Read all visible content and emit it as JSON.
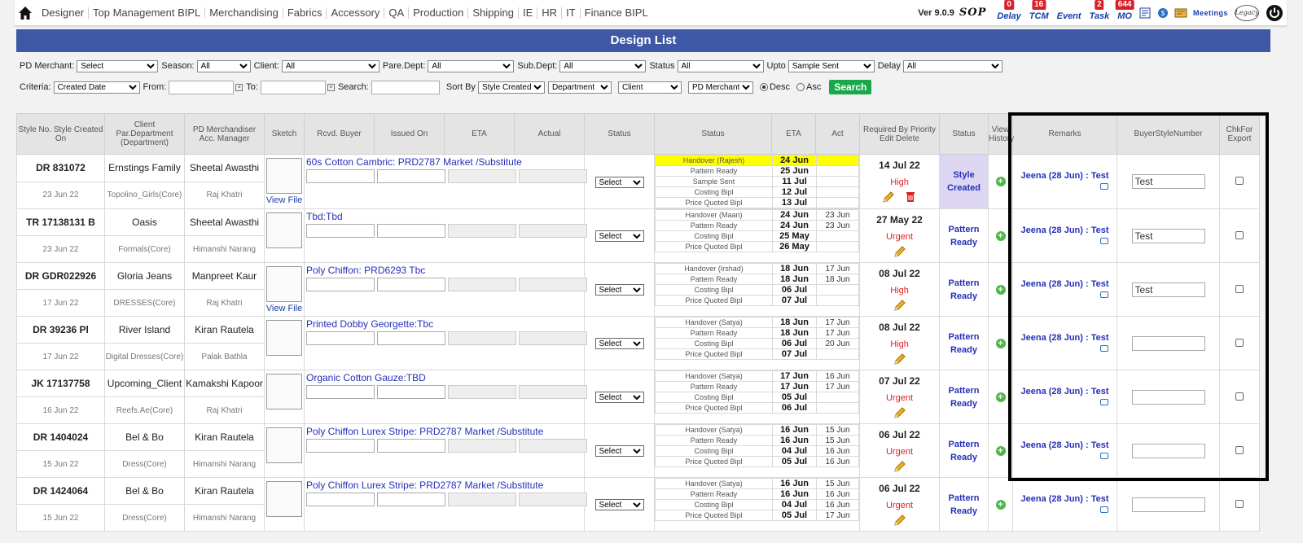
{
  "nav": {
    "menu": [
      "Designer",
      "Top Management BIPL",
      "Merchandising",
      "Fabrics",
      "Accessory",
      "QA",
      "Production",
      "Shipping",
      "IE",
      "HR",
      "IT",
      "Finance BIPL"
    ],
    "version": "Ver 9.0.9",
    "sop": "SOP",
    "tools": [
      {
        "label": "Delay",
        "badge": "0"
      },
      {
        "label": "TCM",
        "badge": "16"
      },
      {
        "label": "Event",
        "badge": ""
      },
      {
        "label": "Task",
        "badge": "2"
      },
      {
        "label": "MO",
        "badge": "644"
      }
    ],
    "meetings": "Meetings",
    "legacy": "Legacy"
  },
  "title": "Design List",
  "filters": {
    "pd_merchant_label": "PD Merchant:",
    "pd_merchant": "Select",
    "season_label": "Season:",
    "season": "All",
    "client_label": "Client:",
    "client": "All",
    "pare_dept_label": "Pare.Dept:",
    "pare_dept": "All",
    "sub_dept_label": "Sub.Dept:",
    "sub_dept": "All",
    "status_label": "Status",
    "status": "All",
    "upto_label": "Upto",
    "upto": "Sample Sent",
    "delay_label": "Delay",
    "delay": "All",
    "criteria_label": "Criteria:",
    "criteria": "Created Date",
    "from_label": "From:",
    "to_label": "To:",
    "search_label": "Search:",
    "sort_label": "Sort By",
    "sort1": "Style Created",
    "sort2": "Department",
    "sort3": "Client",
    "sort4": "PD Merchant",
    "desc": "Desc",
    "asc": "Asc",
    "search_btn": "Search"
  },
  "headers": {
    "style": "Style No. Style Created On",
    "client": "Client Par.Department (Department)",
    "pdm": "PD Merchandiser Acc. Manager",
    "sketch": "Sketch",
    "rcvd": "Rcvd. Buyer",
    "issued": "Issued On",
    "eta": "ETA",
    "actual": "Actual",
    "status1": "Status",
    "status2": "Status",
    "eta2": "ETA",
    "act": "Act",
    "required": "Required By Priority Edit   Delete",
    "status3": "Status",
    "view": "View History",
    "remarks": "Remarks",
    "bsn": "BuyerStyleNumber",
    "chk": "ChkFor Export"
  },
  "rows": [
    {
      "style": "DR 831072",
      "date": "23 Jun 22",
      "client": "Ernstings Family",
      "dept": "Topolino_Girls(Core)",
      "pdm": "Sheetal Awasthi",
      "am": "Raj Khatri",
      "view_file": "View File",
      "fabric": "60s Cotton Cambric: PRD2787 Market /Substitute",
      "select": "Select",
      "stages": [
        {
          "n": "Handover (Rajesh)",
          "e": "24 Jun",
          "a": "",
          "hl": true
        },
        {
          "n": "Pattern Ready",
          "e": "25 Jun",
          "a": ""
        },
        {
          "n": "Sample Sent",
          "e": "11 Jul",
          "a": ""
        },
        {
          "n": "Costing Bipl",
          "e": "12 Jul",
          "a": ""
        },
        {
          "n": "Price Quoted Bipl",
          "e": "13 Jul",
          "a": ""
        }
      ],
      "req": "14 Jul 22",
      "prio": "High",
      "status": "Style Created",
      "status_hl": true,
      "remark": "Jeena (28 Jun) : Test",
      "bsn": "Test",
      "delete": true
    },
    {
      "style": "TR 17138131 B",
      "date": "23 Jun 22",
      "client": "Oasis",
      "dept": "Formals(Core)",
      "pdm": "Sheetal Awasthi",
      "am": "Himanshi Narang",
      "view_file": "",
      "fabric": "Tbd:Tbd",
      "select": "Select",
      "stages": [
        {
          "n": "Handover (Maan)",
          "e": "24 Jun",
          "a": "23 Jun"
        },
        {
          "n": "Pattern Ready",
          "e": "24 Jun",
          "a": "23 Jun"
        },
        {
          "n": "Costing Bipl",
          "e": "25 May",
          "a": ""
        },
        {
          "n": "Price Quoted Bipl",
          "e": "26 May",
          "a": ""
        }
      ],
      "req": "27 May 22",
      "prio": "Urgent",
      "status": "Pattern Ready",
      "remark": "Jeena (28 Jun) : Test",
      "bsn": "Test"
    },
    {
      "style": "DR GDR022926",
      "date": "17 Jun 22",
      "client": "Gloria Jeans",
      "dept": "DRESSES(Core)",
      "pdm": "Manpreet Kaur",
      "am": "Raj Khatri",
      "view_file": "View File",
      "fabric": "Poly Chiffon: PRD6293 Tbc",
      "select": "Select",
      "stages": [
        {
          "n": "Handover (Irshad)",
          "e": "18 Jun",
          "a": "17 Jun"
        },
        {
          "n": "Pattern Ready",
          "e": "18 Jun",
          "a": "18 Jun"
        },
        {
          "n": "Costing Bipl",
          "e": "06 Jul",
          "a": ""
        },
        {
          "n": "Price Quoted Bipl",
          "e": "07 Jul",
          "a": ""
        }
      ],
      "req": "08 Jul 22",
      "prio": "High",
      "status": "Pattern Ready",
      "remark": "Jeena (28 Jun) : Test",
      "bsn": "Test"
    },
    {
      "style": "DR 39236 Pl",
      "date": "17 Jun 22",
      "client": "River Island",
      "dept": "Digital Dresses(Core)",
      "pdm": "Kiran Rautela",
      "am": "Palak Bathla",
      "view_file": "",
      "fabric": "Printed Dobby Georgette:Tbc",
      "select": "Select",
      "stages": [
        {
          "n": "Handover (Satya)",
          "e": "18 Jun",
          "a": "17 Jun"
        },
        {
          "n": "Pattern Ready",
          "e": "18 Jun",
          "a": "17 Jun"
        },
        {
          "n": "Costing Bipl",
          "e": "06 Jul",
          "a": "20 Jun"
        },
        {
          "n": "Price Quoted Bipl",
          "e": "07 Jul",
          "a": ""
        }
      ],
      "req": "08 Jul 22",
      "prio": "High",
      "status": "Pattern Ready",
      "remark": "Jeena (28 Jun) : Test",
      "bsn": ""
    },
    {
      "style": "JK 17137758",
      "date": "16 Jun 22",
      "client": "Upcoming_Client",
      "dept": "Reefs.Ae(Core)",
      "pdm": "Kamakshi Kapoor",
      "am": "Raj Khatri",
      "view_file": "",
      "fabric": "Organic Cotton Gauze:TBD",
      "select": "Select",
      "stages": [
        {
          "n": "Handover (Satya)",
          "e": "17 Jun",
          "a": "16 Jun"
        },
        {
          "n": "Pattern Ready",
          "e": "17 Jun",
          "a": "17 Jun"
        },
        {
          "n": "Costing Bipl",
          "e": "05 Jul",
          "a": ""
        },
        {
          "n": "Price Quoted Bipl",
          "e": "06 Jul",
          "a": ""
        }
      ],
      "req": "07 Jul 22",
      "prio": "Urgent",
      "status": "Pattern Ready",
      "remark": "Jeena (28 Jun) : Test",
      "bsn": ""
    },
    {
      "style": "DR 1404024",
      "date": "15 Jun 22",
      "client": "Bel & Bo",
      "dept": "Dress(Core)",
      "pdm": "Kiran Rautela",
      "am": "Himanshi Narang",
      "view_file": "",
      "fabric": "Poly Chiffon Lurex Stripe: PRD2787 Market /Substitute",
      "select": "Select",
      "stages": [
        {
          "n": "Handover (Satya)",
          "e": "16 Jun",
          "a": "15 Jun"
        },
        {
          "n": "Pattern Ready",
          "e": "16 Jun",
          "a": "15 Jun"
        },
        {
          "n": "Costing Bipl",
          "e": "04 Jul",
          "a": "16 Jun"
        },
        {
          "n": "Price Quoted Bipl",
          "e": "05 Jul",
          "a": "16 Jun"
        }
      ],
      "req": "06 Jul 22",
      "prio": "Urgent",
      "status": "Pattern Ready",
      "remark": "Jeena (28 Jun) : Test",
      "bsn": ""
    },
    {
      "style": "DR 1424064",
      "date": "15 Jun 22",
      "client": "Bel & Bo",
      "dept": "Dress(Core)",
      "pdm": "Kiran Rautela",
      "am": "Himanshi Narang",
      "view_file": "",
      "fabric": "Poly Chiffon Lurex Stripe: PRD2787 Market /Substitute",
      "select": "Select",
      "stages": [
        {
          "n": "Handover (Satya)",
          "e": "16 Jun",
          "a": "15 Jun"
        },
        {
          "n": "Pattern Ready",
          "e": "16 Jun",
          "a": "16 Jun"
        },
        {
          "n": "Costing Bipl",
          "e": "04 Jul",
          "a": "16 Jun"
        },
        {
          "n": "Price Quoted Bipl",
          "e": "05 Jul",
          "a": "17 Jun"
        }
      ],
      "req": "06 Jul 22",
      "prio": "Urgent",
      "status": "Pattern Ready",
      "remark": "Jeena (28 Jun) : Test",
      "bsn": ""
    }
  ]
}
